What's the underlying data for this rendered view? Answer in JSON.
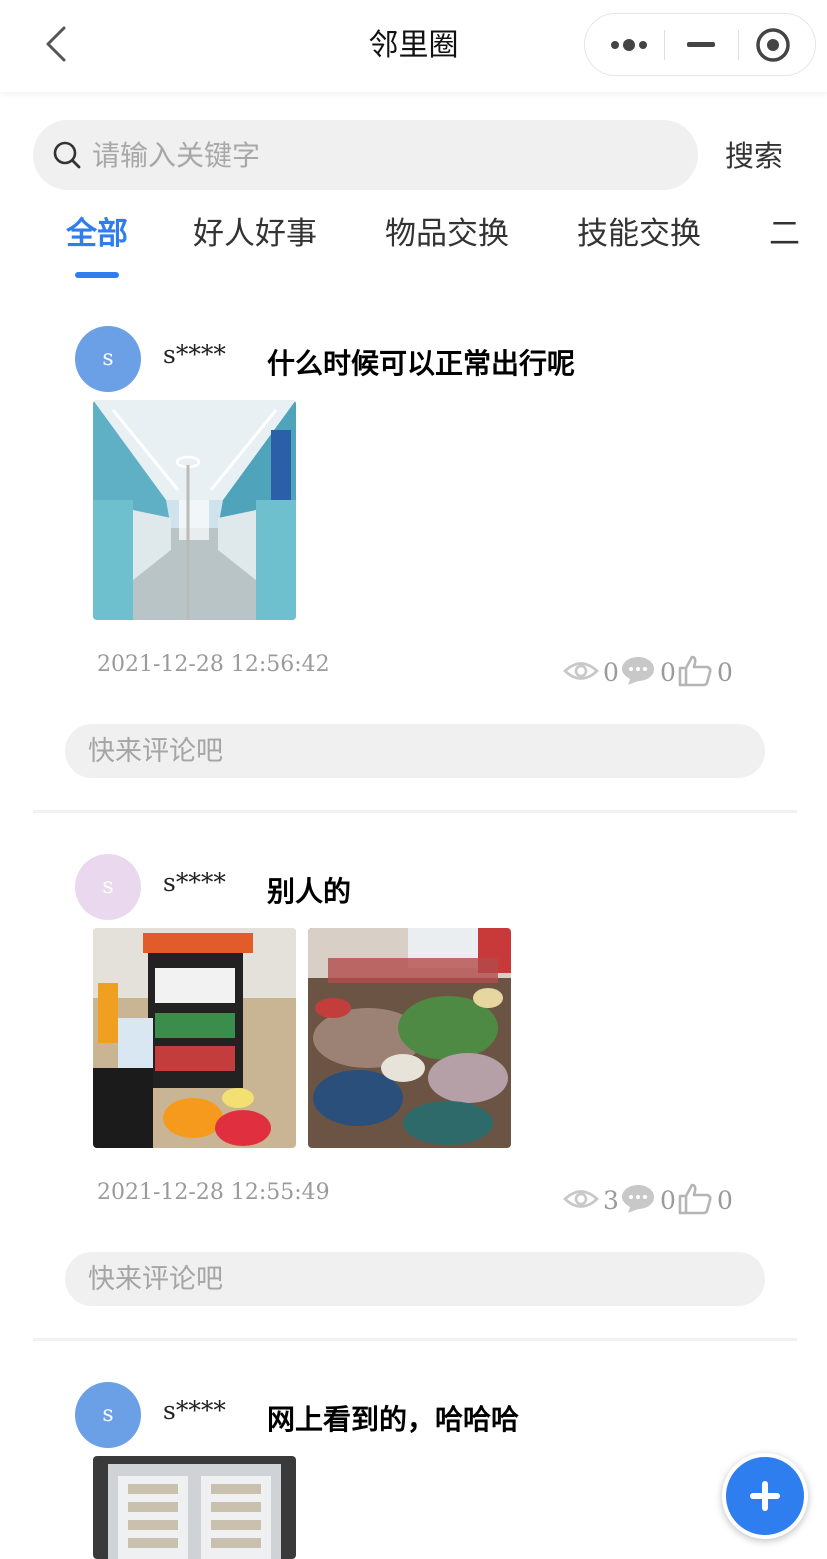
{
  "nav": {
    "title": "邻里圈"
  },
  "search": {
    "placeholder": "请输入关键字",
    "button_label": "搜索"
  },
  "tabs": [
    {
      "label": "全部",
      "active": true
    },
    {
      "label": "好人好事",
      "active": false
    },
    {
      "label": "物品交换",
      "active": false
    },
    {
      "label": "技能交换",
      "active": false
    },
    {
      "label": "二",
      "active": false
    }
  ],
  "posts": [
    {
      "avatar_letter": "s",
      "avatar_color": "#6b9fe6",
      "username": "s****",
      "title": "什么时候可以正常出行呢",
      "time": "2021-12-28 12:56:42",
      "views": "0",
      "comments": "0",
      "likes": "0",
      "comment_placeholder": "快来评论吧"
    },
    {
      "avatar_letter": "s",
      "avatar_color": "#ead9ee",
      "username": "s****",
      "title": "别人的",
      "time": "2021-12-28 12:55:49",
      "views": "3",
      "comments": "0",
      "likes": "0",
      "comment_placeholder": "快来评论吧"
    },
    {
      "avatar_letter": "s",
      "avatar_color": "#6b9fe6",
      "username": "s****",
      "title": "网上看到的，哈哈哈"
    }
  ],
  "colors": {
    "accent": "#2f7ef0",
    "muted_text": "#9a9a9a",
    "input_bg": "#f0f0f0"
  },
  "icons": {
    "back": "chevron-left-icon",
    "more": "more-dots-icon",
    "minimize": "minimize-icon",
    "close": "target-circle-icon",
    "search": "search-icon",
    "views": "eye-icon",
    "comments": "speech-bubble-icon",
    "likes": "thumbs-up-icon",
    "add": "plus-icon"
  }
}
